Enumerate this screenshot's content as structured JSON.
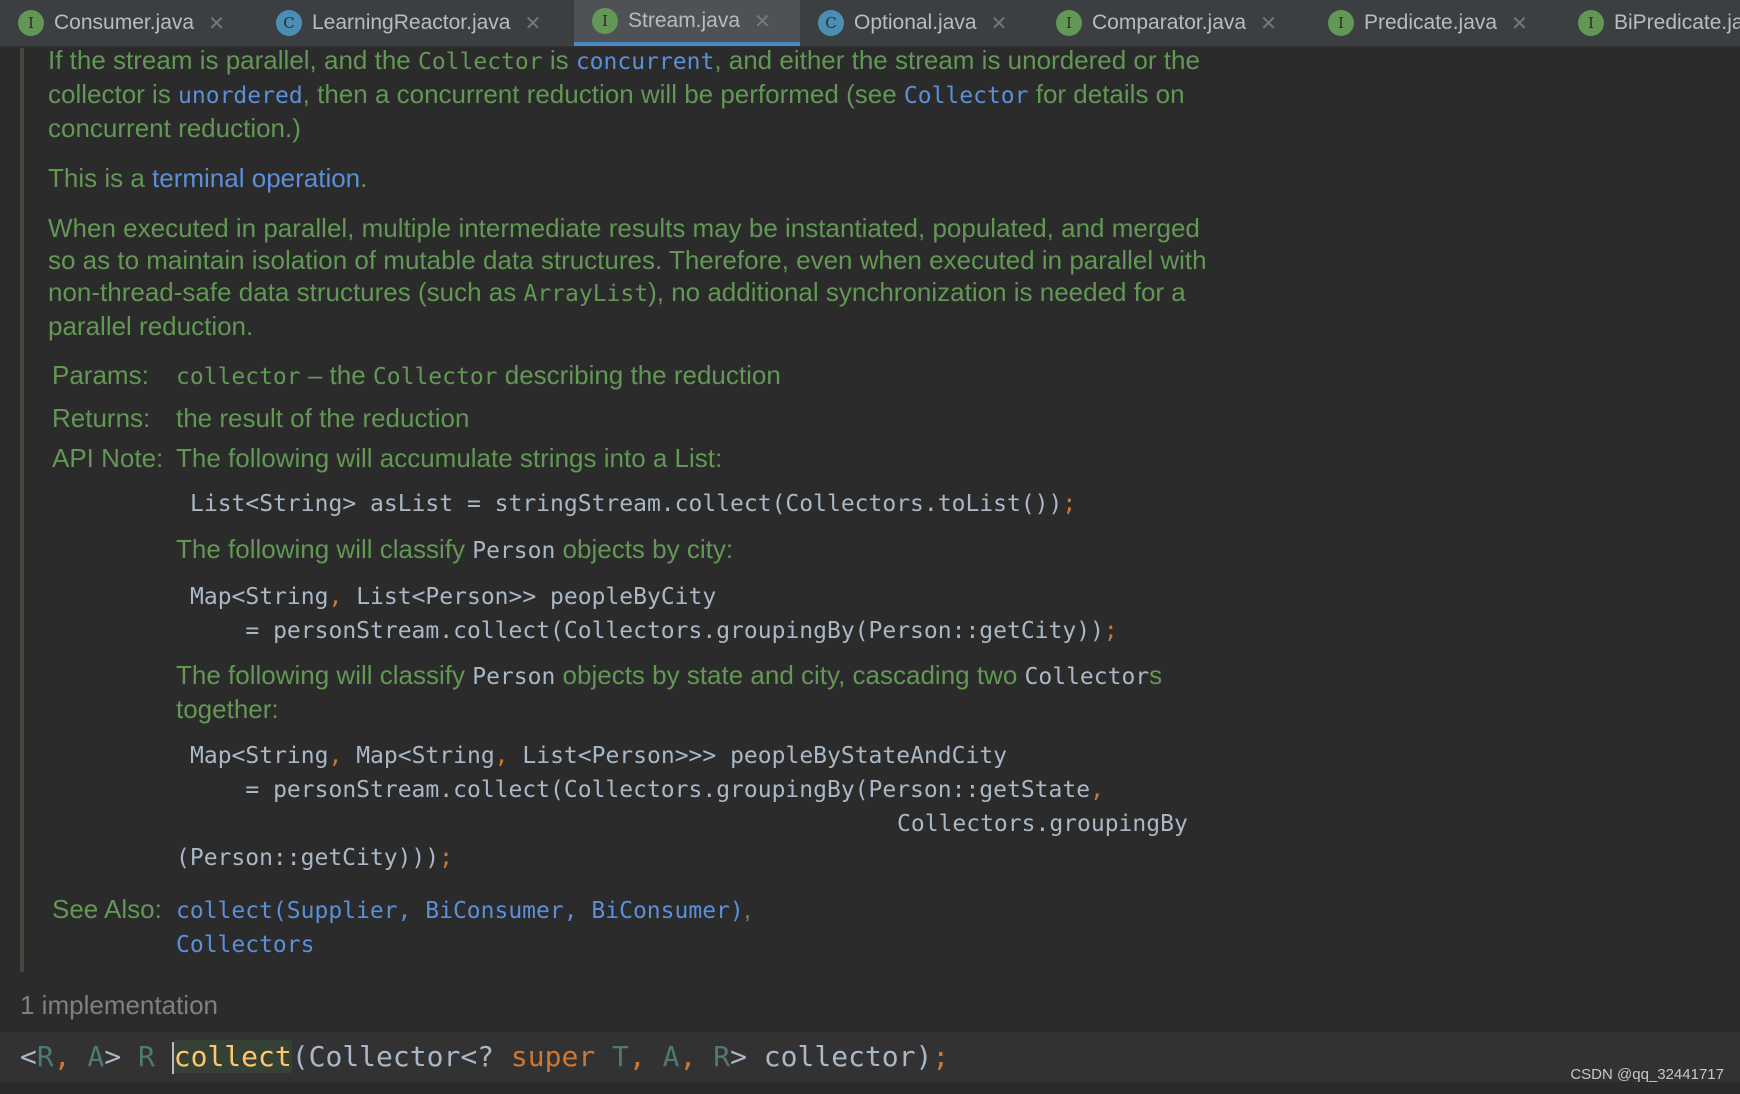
{
  "tabs": [
    {
      "label": "Consumer.java",
      "icon": "interface-icon",
      "kind": "i"
    },
    {
      "label": "LearningReactor.java",
      "icon": "class-run-icon",
      "kind": "c"
    },
    {
      "label": "Stream.java",
      "icon": "interface-icon",
      "kind": "i",
      "active": true
    },
    {
      "label": "Optional.java",
      "icon": "class-icon",
      "kind": "c"
    },
    {
      "label": "Comparator.java",
      "icon": "interface-icon",
      "kind": "i"
    },
    {
      "label": "Predicate.java",
      "icon": "interface-icon",
      "kind": "i"
    },
    {
      "label": "BiPredicate.java",
      "icon": "interface-icon",
      "kind": "i"
    }
  ],
  "colors": {
    "doc_text": "#629755",
    "link": "#5b8fd8",
    "keyword": "#cc7832",
    "background": "#2b2b2b",
    "active_tab_underline": "#4a88c7"
  },
  "doc": {
    "lines": [
      [
        [
          "text",
          "If the stream is parallel, and the "
        ],
        [
          "code",
          "Collector"
        ],
        [
          "text",
          " is "
        ],
        [
          "linkcode",
          "concurrent"
        ],
        [
          "text",
          ", and either the stream is unordered or the"
        ]
      ],
      [
        [
          "text",
          "collector is "
        ],
        [
          "linkcode",
          "unordered"
        ],
        [
          "text",
          ", then a concurrent reduction will be performed (see "
        ],
        [
          "linkcode",
          "Collector"
        ],
        [
          "text",
          " for details on"
        ]
      ],
      [
        [
          "text",
          "concurrent reduction.)"
        ]
      ],
      [
        [
          "text",
          "This is a "
        ],
        [
          "link",
          "terminal operation"
        ],
        [
          "text",
          "."
        ]
      ],
      [
        [
          "text",
          "When executed in parallel, multiple intermediate results may be instantiated, populated, and merged"
        ]
      ],
      [
        [
          "text",
          "so as to maintain isolation of mutable data structures. Therefore, even when executed in parallel with"
        ]
      ],
      [
        [
          "text",
          "non-thread-safe data structures (such as "
        ],
        [
          "code",
          "ArrayList"
        ],
        [
          "text",
          "), no additional synchronization is needed for a"
        ]
      ],
      [
        [
          "text",
          "parallel reduction."
        ]
      ],
      [
        [
          "code",
          "collector"
        ],
        [
          "text",
          " – the "
        ],
        [
          "code",
          "Collector"
        ],
        [
          "text",
          " describing the reduction"
        ]
      ],
      [
        [
          "text",
          "the result of the reduction"
        ]
      ],
      [
        [
          "text",
          "The following will accumulate strings into a List:"
        ]
      ],
      [
        [
          "codeplain",
          "List<String> asList = stringStream.collect(Collectors.toList())"
        ],
        [
          "punct",
          ";"
        ]
      ],
      [
        [
          "text",
          "The following will classify "
        ],
        [
          "codeplain",
          "Person"
        ],
        [
          "text",
          " objects by city:"
        ]
      ],
      [
        [
          "codeplain",
          "Map<String"
        ],
        [
          "punct",
          ","
        ],
        [
          "codeplain",
          " List<Person>> peopleByCity"
        ]
      ],
      [
        [
          "codeplain",
          "    = personStream.collect(Collectors.groupingBy(Person::getCity))"
        ],
        [
          "punct",
          ";"
        ]
      ],
      [
        [
          "text",
          "The following will classify "
        ],
        [
          "codeplain",
          "Person"
        ],
        [
          "text",
          " objects by state and city, cascading two "
        ],
        [
          "codeplain",
          "Collector"
        ],
        [
          "text",
          "s"
        ]
      ],
      [
        [
          "text",
          "together:"
        ]
      ],
      [
        [
          "codeplain",
          "Map<String"
        ],
        [
          "punct",
          ","
        ],
        [
          "codeplain",
          " Map<String"
        ],
        [
          "punct",
          ","
        ],
        [
          "codeplain",
          " List<Person>>> peopleByStateAndCity"
        ]
      ],
      [
        [
          "codeplain",
          "    = personStream.collect(Collectors.groupingBy(Person::getState"
        ],
        [
          "punct",
          ","
        ]
      ],
      [
        [
          "codeplain",
          "Collectors.groupingBy"
        ]
      ],
      [
        [
          "codeplain",
          "(Person::getCity)))"
        ],
        [
          "punct",
          ";"
        ]
      ],
      [
        [
          "linkcode",
          "collect(Supplier, BiConsumer, BiConsumer)"
        ],
        [
          "text",
          ","
        ]
      ],
      [
        [
          "linkcode",
          "Collectors"
        ]
      ]
    ],
    "labels": {
      "params": "Params:",
      "returns": "Returns:",
      "api_note": "API Note:",
      "see_also": "See Also:"
    }
  },
  "implementations": "1 implementation",
  "signature": {
    "p1": "<",
    "r": "R",
    "c1": ",",
    "a": " A",
    "p2": "> ",
    "r2": "R ",
    "name": "collect",
    "p3": "(Collector<? ",
    "super": "super",
    "t": " T",
    "c2": ",",
    "a2": " A",
    "c3": ",",
    "r3": " R",
    "p4": "> collector)",
    "semi": ";"
  },
  "watermark": "CSDN @qq_32441717"
}
